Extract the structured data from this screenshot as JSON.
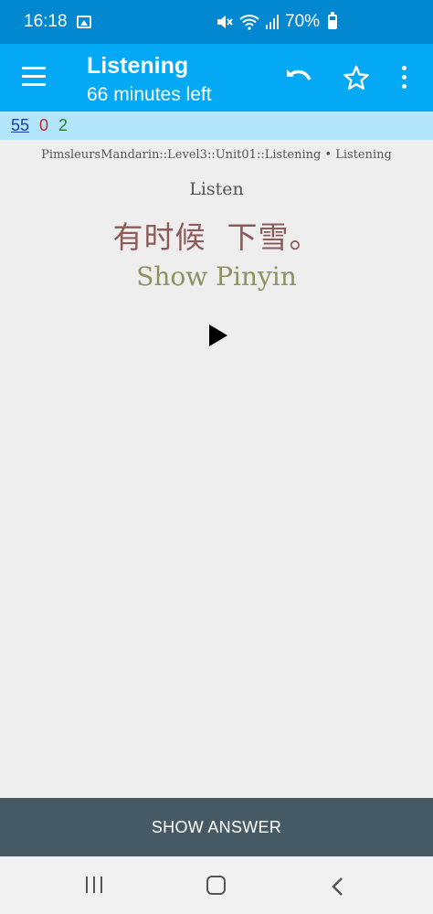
{
  "status_bar": {
    "time": "16:18",
    "battery": "70%",
    "icons": [
      "image-icon",
      "mute-icon",
      "wifi-icon",
      "signal-icon",
      "battery-icon"
    ]
  },
  "app_bar": {
    "title": "Listening",
    "subtitle": "66 minutes left",
    "icons": [
      "menu-icon",
      "undo-icon",
      "star-icon",
      "more-icon"
    ]
  },
  "counts": {
    "new": "55",
    "learning": "0",
    "review": "2"
  },
  "card": {
    "deck_path": "PimsleursMandarin::Level3::Unit01::Listening • Listening",
    "prompt": "Listen",
    "hanzi": "有时候  下雪。",
    "pinyin_link": "Show Pinyin"
  },
  "answer_button": "SHOW ANSWER",
  "colors": {
    "status_bar": "#0288d1",
    "app_bar": "#03a9f4",
    "counts_bar": "#b3e5fc",
    "answer_bar": "#455a64",
    "hanzi": "#8e5b5b",
    "pinyin": "#8f9260"
  }
}
